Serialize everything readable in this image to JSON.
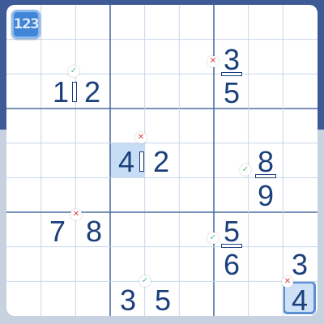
{
  "mode_button": {
    "label": "123",
    "icon": "number-mode-icon"
  },
  "colors": {
    "digit": "#1a3f7a",
    "grid_thin": "#c9d6ea",
    "grid_thick": "#4e6f9f",
    "check": "#3ec18b",
    "cross": "#e0403f",
    "highlight": "#c7ddf6",
    "selected_border": "#5d8fd2"
  },
  "marks": {
    "check": "✓",
    "cross": "✕"
  },
  "clues": [
    {
      "type": "pair",
      "left": "1",
      "right": "2",
      "mark": "check"
    },
    {
      "type": "fraction",
      "top": "3",
      "bottom": "5",
      "mark": "cross"
    },
    {
      "type": "pair",
      "left": "4",
      "right": "2",
      "mark": "cross"
    },
    {
      "type": "fraction",
      "top": "8",
      "bottom": "9",
      "mark": "check"
    },
    {
      "type": "sum",
      "left": "7",
      "right": "8",
      "mark": "cross"
    },
    {
      "type": "fraction",
      "top": "5",
      "bottom": "6",
      "mark": "check"
    },
    {
      "type": "vertical",
      "top": "3",
      "bottom": "4",
      "mark": "cross"
    },
    {
      "type": "sum",
      "left": "3",
      "right": "5",
      "mark": "check"
    }
  ]
}
